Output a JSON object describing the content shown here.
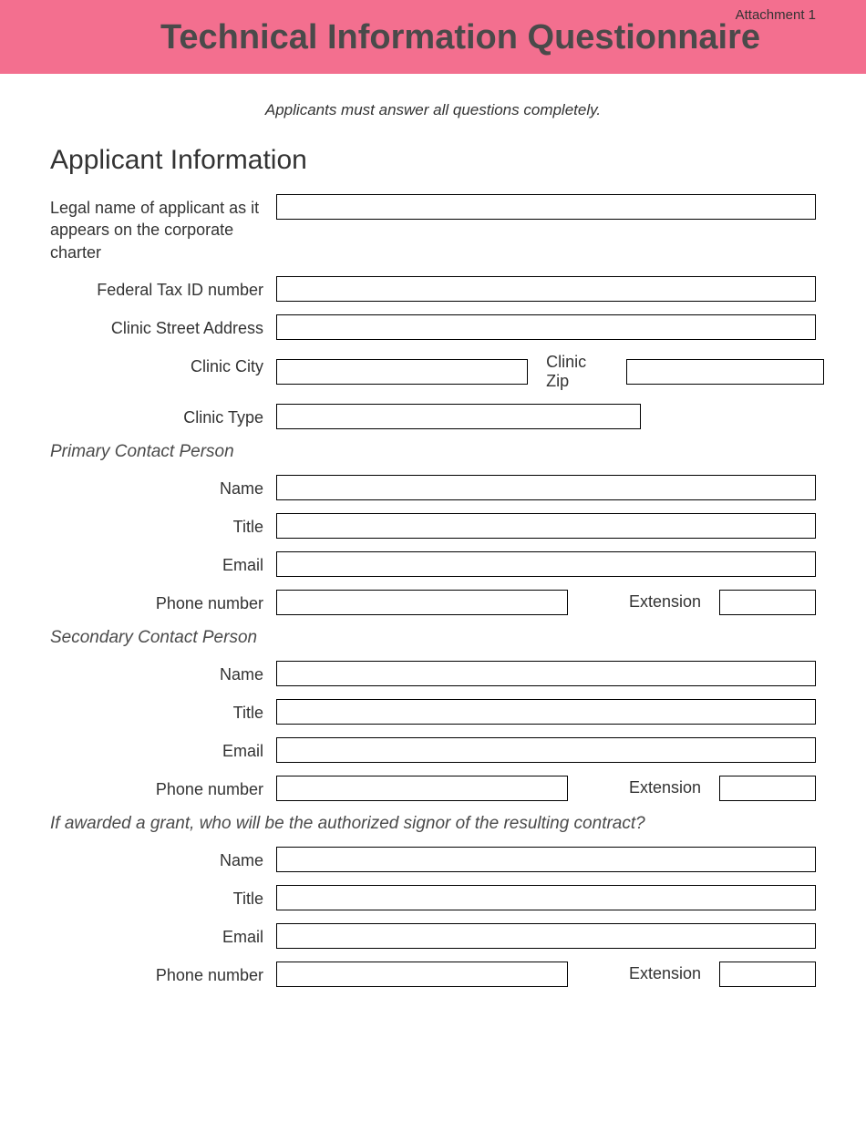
{
  "header": {
    "attachment": "Attachment 1",
    "title": "Technical Information Questionnaire"
  },
  "instruction": "Applicants must answer all questions completely.",
  "section_title": "Applicant Information",
  "fields": {
    "legal_name_label": "Legal name of applicant as it appears on the corporate charter",
    "legal_name_value": "",
    "tax_id_label": "Federal Tax ID number",
    "tax_id_value": "",
    "street_label": "Clinic Street Address",
    "street_value": "",
    "city_label": "Clinic City",
    "city_value": "",
    "zip_label": "Clinic Zip",
    "zip_value": "",
    "type_label": "Clinic Type",
    "type_value": ""
  },
  "primary": {
    "heading": "Primary Contact Person",
    "name_label": "Name",
    "name_value": "",
    "title_label": "Title",
    "title_value": "",
    "email_label": "Email",
    "email_value": "",
    "phone_label": "Phone number",
    "phone_value": "",
    "ext_label": "Extension",
    "ext_value": ""
  },
  "secondary": {
    "heading": "Secondary Contact Person",
    "name_label": "Name",
    "name_value": "",
    "title_label": "Title",
    "title_value": "",
    "email_label": "Email",
    "email_value": "",
    "phone_label": "Phone number",
    "phone_value": "",
    "ext_label": "Extension",
    "ext_value": ""
  },
  "signor": {
    "heading": "If awarded a grant, who will be the authorized signor of the resulting contract?",
    "name_label": "Name",
    "name_value": "",
    "title_label": "Title",
    "title_value": "",
    "email_label": "Email",
    "email_value": "",
    "phone_label": "Phone number",
    "phone_value": "",
    "ext_label": "Extension",
    "ext_value": ""
  }
}
